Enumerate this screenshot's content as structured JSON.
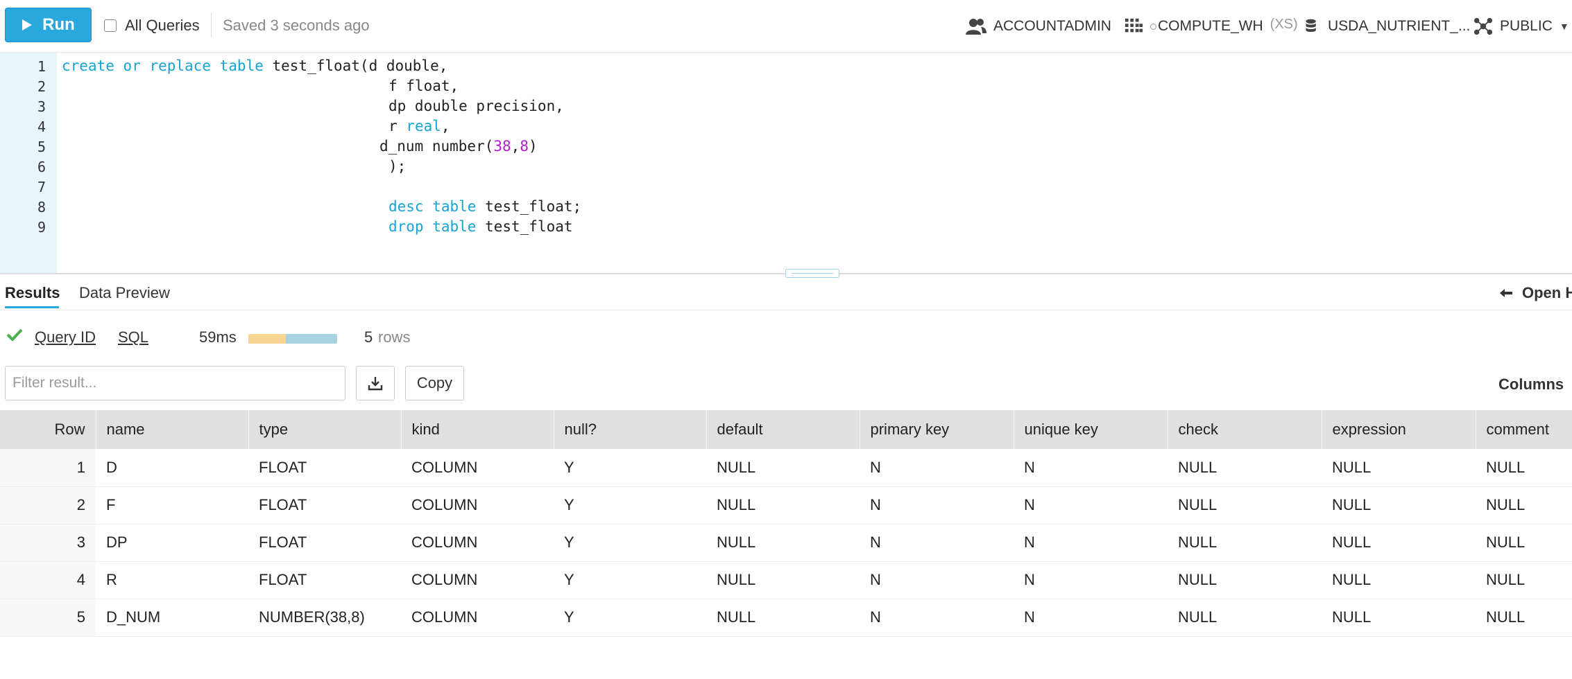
{
  "toolbar": {
    "run_label": "Run",
    "all_queries_label": "All Queries",
    "saved_status": "Saved 3 seconds ago",
    "role": "ACCOUNTADMIN",
    "warehouse": "COMPUTE_WH",
    "warehouse_size": "(XS)",
    "database": "USDA_NUTRIENT_...",
    "schema": "PUBLIC"
  },
  "editor": {
    "line_numbers": [
      "1",
      "2",
      "3",
      "4",
      "5",
      "6",
      "7",
      "8",
      "9"
    ],
    "lines": [
      [
        {
          "t": "create",
          "k": "kw"
        },
        {
          "t": " "
        },
        {
          "t": "or",
          "k": "kw"
        },
        {
          "t": " "
        },
        {
          "t": "replace",
          "k": "kw"
        },
        {
          "t": " "
        },
        {
          "t": "table",
          "k": "kw"
        },
        {
          "t": " test_float(d double,"
        }
      ],
      [
        {
          "t": "f float,"
        }
      ],
      [
        {
          "t": "dp double precision,"
        }
      ],
      [
        {
          "t": "r "
        },
        {
          "t": "real",
          "k": "kw"
        },
        {
          "t": ","
        }
      ],
      [
        {
          "t": "d_num number("
        },
        {
          "t": "38",
          "k": "num"
        },
        {
          "t": ","
        },
        {
          "t": "8",
          "k": "num"
        },
        {
          "t": ")"
        }
      ],
      [
        {
          "t": ");"
        }
      ],
      [],
      [
        {
          "t": "desc",
          "k": "kw"
        },
        {
          "t": " "
        },
        {
          "t": "table",
          "k": "kw"
        },
        {
          "t": " test_float;"
        }
      ],
      [
        {
          "t": "drop",
          "k": "kw"
        },
        {
          "t": " "
        },
        {
          "t": "table",
          "k": "kw"
        },
        {
          "t": " test_float"
        }
      ]
    ]
  },
  "results": {
    "tabs": [
      "Results",
      "Data Preview"
    ],
    "open_history_label": "Open H",
    "query_id_label": "Query ID",
    "sql_label": "SQL",
    "duration": "59ms",
    "duration_split": [
      0.42,
      0.58
    ],
    "row_count": "5",
    "rows_label": "rows",
    "filter_placeholder": "Filter result...",
    "copy_label": "Copy",
    "columns_label": "Columns",
    "colors": {
      "bar_compile": "#f7d593",
      "bar_exec": "#a6d3df",
      "success": "#4caf50",
      "accent": "#29a8dd"
    },
    "table": {
      "headers": [
        "Row",
        "name",
        "type",
        "kind",
        "null?",
        "default",
        "primary key",
        "unique key",
        "check",
        "expression",
        "comment"
      ],
      "rows": [
        [
          "1",
          "D",
          "FLOAT",
          "COLUMN",
          "Y",
          "NULL",
          "N",
          "N",
          "NULL",
          "NULL",
          "NULL"
        ],
        [
          "2",
          "F",
          "FLOAT",
          "COLUMN",
          "Y",
          "NULL",
          "N",
          "N",
          "NULL",
          "NULL",
          "NULL"
        ],
        [
          "3",
          "DP",
          "FLOAT",
          "COLUMN",
          "Y",
          "NULL",
          "N",
          "N",
          "NULL",
          "NULL",
          "NULL"
        ],
        [
          "4",
          "R",
          "FLOAT",
          "COLUMN",
          "Y",
          "NULL",
          "N",
          "N",
          "NULL",
          "NULL",
          "NULL"
        ],
        [
          "5",
          "D_NUM",
          "NUMBER(38,8)",
          "COLUMN",
          "Y",
          "NULL",
          "N",
          "N",
          "NULL",
          "NULL",
          "NULL"
        ]
      ]
    }
  }
}
